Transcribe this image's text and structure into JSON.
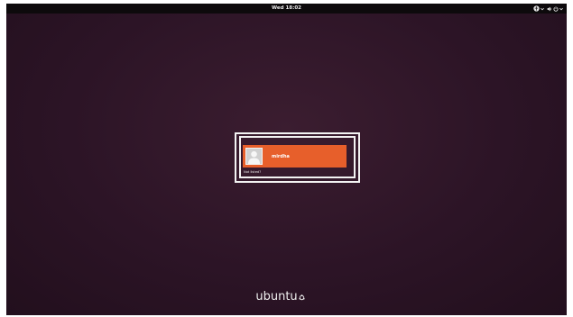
{
  "topbar": {
    "clock": "Wed 18:02",
    "tray": {
      "accessibility_icon": "accessibility-icon",
      "volume_icon": "volume-icon",
      "power_icon": "power-icon",
      "dropdown_icon": "chevron-down-icon"
    }
  },
  "login": {
    "users": [
      {
        "name": "mirdha",
        "avatar_icon": "user-avatar-icon"
      }
    ],
    "not_listed_label": "Not listed?"
  },
  "branding": {
    "logo_text": "ubuntu",
    "logo_mark": "circle-of-friends-icon"
  },
  "colors": {
    "background": "#2c1426",
    "topbar": "#0d0a0c",
    "accent": "#e75f2b",
    "highlight_border": "#f3f3f3"
  }
}
